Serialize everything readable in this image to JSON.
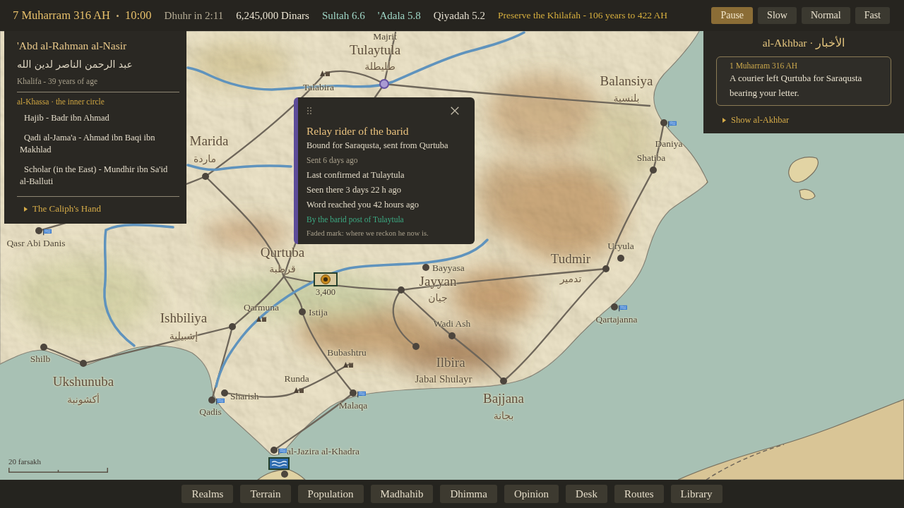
{
  "top_bar": {
    "date": "7 Muharram 316 AH",
    "time": "10:00",
    "prayer": "Dhuhr in 2:11",
    "treasury": "6,245,000 Dinars",
    "stats": [
      {
        "label": "Sultah 6.6",
        "color": "#9fd6c6"
      },
      {
        "label": "'Adala 5.8",
        "color": "#9fd6c6"
      },
      {
        "label": "Qiyadah 5.2",
        "color": "#e2dccd"
      }
    ],
    "goal": "Preserve the Khilafah - 106 years to 422 AH",
    "speeds": [
      {
        "label": "Pause",
        "selected": true
      },
      {
        "label": "Slow",
        "selected": false
      },
      {
        "label": "Normal",
        "selected": false
      },
      {
        "label": "Fast",
        "selected": false
      }
    ]
  },
  "ruler_panel": {
    "name": "'Abd al-Rahman al-Nasir",
    "arabic_name": "عبد الرحمن الناصر لدين الله",
    "subtitle": "Khalifa - 39 years of age",
    "circle_heading": "al-Khassa · the inner circle",
    "circle": [
      "Hajib - Badr ibn Ahmad",
      "Qadi al-Jama'a - Ahmad ibn Baqi ibn Makhlad",
      "Scholar (in the East) - Mundhir ibn Sa'id al-Balluti"
    ],
    "section": {
      "label": "The Caliph's Hand",
      "expanded": false
    }
  },
  "rider_popup": {
    "title": "Relay rider of the barid",
    "lines": [
      {
        "kind": "detail",
        "text": "Bound for Saraqusta, sent from Qurtuba"
      },
      {
        "kind": "muted",
        "text": "Sent 6 days ago"
      },
      {
        "kind": "detail",
        "text": "Last confirmed at Tulaytula"
      },
      {
        "kind": "detail",
        "text": "Seen there 3 days 22 h ago"
      },
      {
        "kind": "detail",
        "text": "Word reached you 42 hours ago"
      },
      {
        "kind": "source",
        "text": "By the barid post of Tulaytula"
      },
      {
        "kind": "note",
        "text": "Faded mark: where we reckon he now is."
      }
    ]
  },
  "news_panel": {
    "title": "al-Akhbar · الأخبار",
    "entries": [
      {
        "date": "1 Muharram 316 AH",
        "text": "A courier left Qurtuba for Saraqusta bearing your letter."
      }
    ],
    "toggle": {
      "label": "Show al-Akhbar",
      "expanded": false
    }
  },
  "map": {
    "cities": [
      {
        "name": "Tulaytula",
        "arabic": "طليطلة",
        "kind": "rider"
      },
      {
        "name": "Balansiya",
        "arabic": "بلنسية",
        "kind": "label"
      },
      {
        "name": "Marida",
        "arabic": "ماردة",
        "kind": "dot"
      },
      {
        "name": "Qurtuba",
        "arabic": "قرطبة",
        "kind": "label"
      },
      {
        "name": "Tudmir",
        "arabic": "تدمير",
        "kind": "dot"
      },
      {
        "name": "Jayyan",
        "arabic": "جيان",
        "kind": "dot"
      },
      {
        "name": "Ishbiliya",
        "arabic": "إشبيلية",
        "kind": "dot"
      },
      {
        "name": "Ilbira",
        "kind": "dot"
      },
      {
        "name": "Ukshunuba",
        "arabic": "أكشونبة",
        "kind": "dot"
      },
      {
        "name": "Bajjana",
        "arabic": "بجانة",
        "kind": "dot"
      }
    ],
    "towns": [
      {
        "name": "Majrit",
        "kind": "label"
      },
      {
        "name": "Talabira",
        "kind": "fort"
      },
      {
        "name": "Daniya",
        "kind": "port"
      },
      {
        "name": "Shatiba",
        "kind": "dot"
      },
      {
        "name": "Qasr Abi Danis",
        "kind": "port"
      },
      {
        "name": "Uryula",
        "kind": "dot"
      },
      {
        "name": "Bayyasa",
        "kind": "dot"
      },
      {
        "name": "Qarmuna",
        "kind": "fort"
      },
      {
        "name": "Istija",
        "kind": "dot"
      },
      {
        "name": "Wadi Ash",
        "kind": "dot"
      },
      {
        "name": "Qartajanna",
        "kind": "port"
      },
      {
        "name": "Shilb",
        "kind": "dot"
      },
      {
        "name": "Bubashtru",
        "kind": "fort"
      },
      {
        "name": "Runda",
        "kind": "fort"
      },
      {
        "name": "Sharish",
        "kind": "dot"
      },
      {
        "name": "Qadis",
        "kind": "port"
      },
      {
        "name": "Malaqa",
        "kind": "port"
      },
      {
        "name": "al-Jazira al-Khadra",
        "kind": "port"
      }
    ],
    "features": [
      {
        "name": "Jabal Shulayr"
      }
    ],
    "army": {
      "count": "3,400"
    },
    "scale": "20 farsakh"
  },
  "bottom_bar": {
    "buttons": [
      {
        "label": "Realms",
        "selected": false
      },
      {
        "label": "Terrain",
        "selected": false
      },
      {
        "label": "Population",
        "selected": false
      },
      {
        "label": "Madhahib",
        "selected": false
      },
      {
        "label": "Dhimma",
        "selected": false
      },
      {
        "label": "Opinion",
        "selected": false
      },
      {
        "label": "Desk",
        "selected": false
      },
      {
        "label": "Routes",
        "selected": false
      },
      {
        "label": "Library",
        "selected": false
      }
    ]
  }
}
